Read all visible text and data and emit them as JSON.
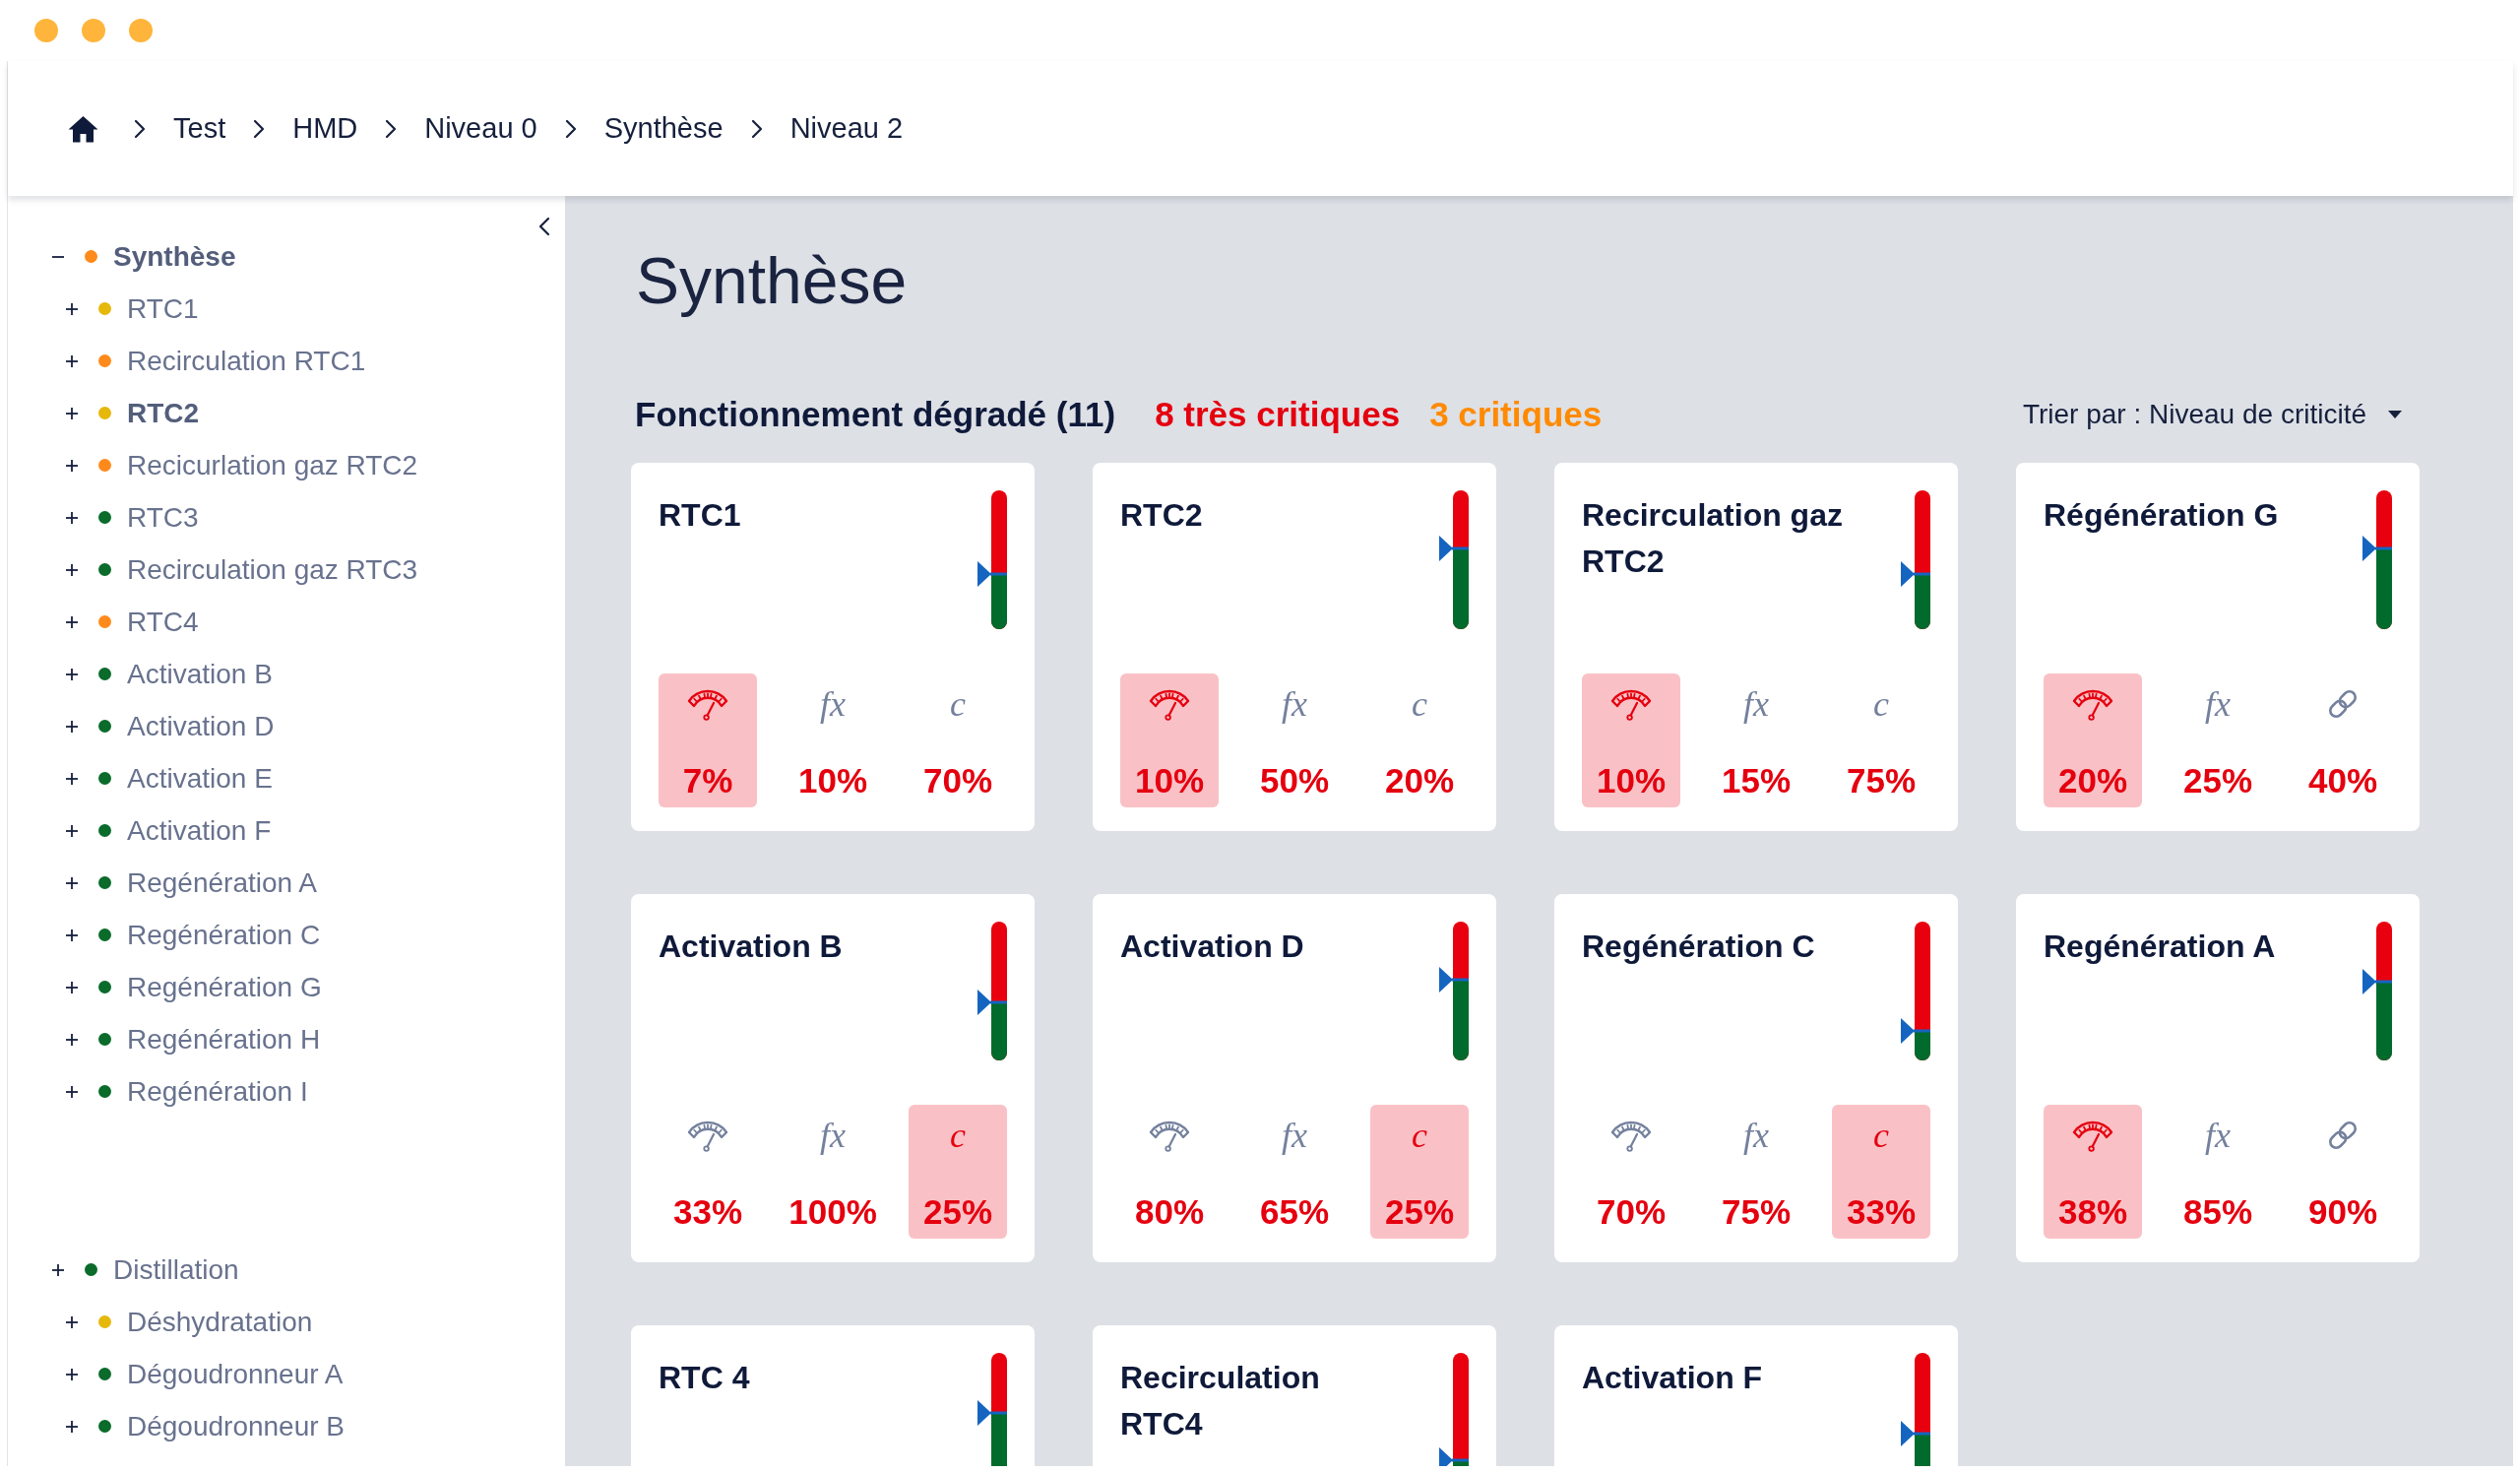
{
  "breadcrumb": {
    "items": [
      "Test",
      "HMD",
      "Niveau 0",
      "Synthèse",
      "Niveau 2"
    ]
  },
  "sidebar": {
    "tree": [
      {
        "label": "Synthèse",
        "color": "#ff8a1c",
        "selected": true,
        "expanded": true,
        "children": [
          {
            "label": "RTC1",
            "color": "#e6b80b",
            "selected": false,
            "expanded": false
          },
          {
            "label": "Recirculation RTC1",
            "color": "#ff8a1c",
            "selected": false,
            "expanded": false
          },
          {
            "label": "RTC2",
            "color": "#e6b80b",
            "selected": true,
            "expanded": false
          },
          {
            "label": "Recicurlation gaz RTC2",
            "color": "#ff8a1c",
            "selected": false,
            "expanded": false
          },
          {
            "label": "RTC3",
            "color": "#0a6b2a",
            "selected": false,
            "expanded": false
          },
          {
            "label": "Recirculation gaz RTC3",
            "color": "#0a6b2a",
            "selected": false,
            "expanded": false
          },
          {
            "label": "RTC4",
            "color": "#ff8a1c",
            "selected": false,
            "expanded": false
          },
          {
            "label": "Activation B",
            "color": "#0a6b2a",
            "selected": false,
            "expanded": false
          },
          {
            "label": "Activation D",
            "color": "#0a6b2a",
            "selected": false,
            "expanded": false
          },
          {
            "label": "Activation E",
            "color": "#0a6b2a",
            "selected": false,
            "expanded": false
          },
          {
            "label": "Activation F",
            "color": "#0a6b2a",
            "selected": false,
            "expanded": false
          },
          {
            "label": "Regénération A",
            "color": "#0a6b2a",
            "selected": false,
            "expanded": false
          },
          {
            "label": "Regénération C",
            "color": "#0a6b2a",
            "selected": false,
            "expanded": false
          },
          {
            "label": "Regénération G",
            "color": "#0a6b2a",
            "selected": false,
            "expanded": false
          },
          {
            "label": "Regénération H",
            "color": "#0a6b2a",
            "selected": false,
            "expanded": false
          },
          {
            "label": "Regénération I",
            "color": "#0a6b2a",
            "selected": false,
            "expanded": false
          }
        ]
      },
      {
        "label": "Distillation",
        "color": "#0a6b2a",
        "selected": false,
        "expanded": false,
        "children": [
          {
            "label": "Déshydratation",
            "color": "#e6b80b",
            "selected": false,
            "expanded": false
          },
          {
            "label": "Dégoudronneur A",
            "color": "#0a6b2a",
            "selected": false,
            "expanded": false
          },
          {
            "label": "Dégoudronneur B",
            "color": "#0a6b2a",
            "selected": false,
            "expanded": false
          }
        ]
      }
    ]
  },
  "main": {
    "title": "Synthèse",
    "summary": {
      "heading": "Fonctionnement dégradé (11)",
      "counts": [
        {
          "label": "8 très critiques",
          "color": "#e5000f"
        },
        {
          "label": "3 critiques",
          "color": "#ff8a00"
        }
      ]
    },
    "sort": {
      "label": "Trier par : Niveau de criticité"
    },
    "cards": [
      {
        "title": "RTC1",
        "level": 0.4,
        "metrics": [
          {
            "kind": "gauge",
            "value": "7%",
            "highlighted": true
          },
          {
            "kind": "glyph",
            "glyph": "fx",
            "value": "10%",
            "highlighted": false
          },
          {
            "kind": "glyph",
            "glyph": "c",
            "value": "70%",
            "highlighted": false
          }
        ]
      },
      {
        "title": "RTC2",
        "level": 0.58,
        "metrics": [
          {
            "kind": "gauge",
            "value": "10%",
            "highlighted": true
          },
          {
            "kind": "glyph",
            "glyph": "fx",
            "value": "50%",
            "highlighted": false
          },
          {
            "kind": "glyph",
            "glyph": "c",
            "value": "20%",
            "highlighted": false
          }
        ]
      },
      {
        "title": "Recirculation gaz RTC2",
        "level": 0.4,
        "metrics": [
          {
            "kind": "gauge",
            "value": "10%",
            "highlighted": true
          },
          {
            "kind": "glyph",
            "glyph": "fx",
            "value": "15%",
            "highlighted": false
          },
          {
            "kind": "glyph",
            "glyph": "c",
            "value": "75%",
            "highlighted": false
          }
        ]
      },
      {
        "title": "Régénération G",
        "level": 0.58,
        "metrics": [
          {
            "kind": "gauge",
            "value": "20%",
            "highlighted": true
          },
          {
            "kind": "glyph",
            "glyph": "fx",
            "value": "25%",
            "highlighted": false
          },
          {
            "kind": "link",
            "value": "40%",
            "highlighted": false
          }
        ]
      },
      {
        "title": "Activation B",
        "level": 0.42,
        "metrics": [
          {
            "kind": "gauge",
            "value": "33%",
            "highlighted": false
          },
          {
            "kind": "glyph",
            "glyph": "fx",
            "value": "100%",
            "highlighted": false
          },
          {
            "kind": "glyph",
            "glyph": "c",
            "value": "25%",
            "highlighted": true
          }
        ]
      },
      {
        "title": "Activation D",
        "level": 0.58,
        "metrics": [
          {
            "kind": "gauge",
            "value": "80%",
            "highlighted": false
          },
          {
            "kind": "glyph",
            "glyph": "fx",
            "value": "65%",
            "highlighted": false
          },
          {
            "kind": "glyph",
            "glyph": "c",
            "value": "25%",
            "highlighted": true
          }
        ]
      },
      {
        "title": "Regénération C",
        "level": 0.21,
        "metrics": [
          {
            "kind": "gauge",
            "value": "70%",
            "highlighted": false
          },
          {
            "kind": "glyph",
            "glyph": "fx",
            "value": "75%",
            "highlighted": false
          },
          {
            "kind": "glyph",
            "glyph": "c",
            "value": "33%",
            "highlighted": true
          }
        ]
      },
      {
        "title": "Regénération A",
        "level": 0.57,
        "metrics": [
          {
            "kind": "gauge",
            "value": "38%",
            "highlighted": true
          },
          {
            "kind": "glyph",
            "glyph": "fx",
            "value": "85%",
            "highlighted": false
          },
          {
            "kind": "link",
            "value": "90%",
            "highlighted": false
          }
        ]
      },
      {
        "title": "RTC 4",
        "level": 0.57
      },
      {
        "title": "Recirculation RTC4",
        "level": 0.23
      },
      {
        "title": "Activation F",
        "level": 0.42
      }
    ]
  }
}
